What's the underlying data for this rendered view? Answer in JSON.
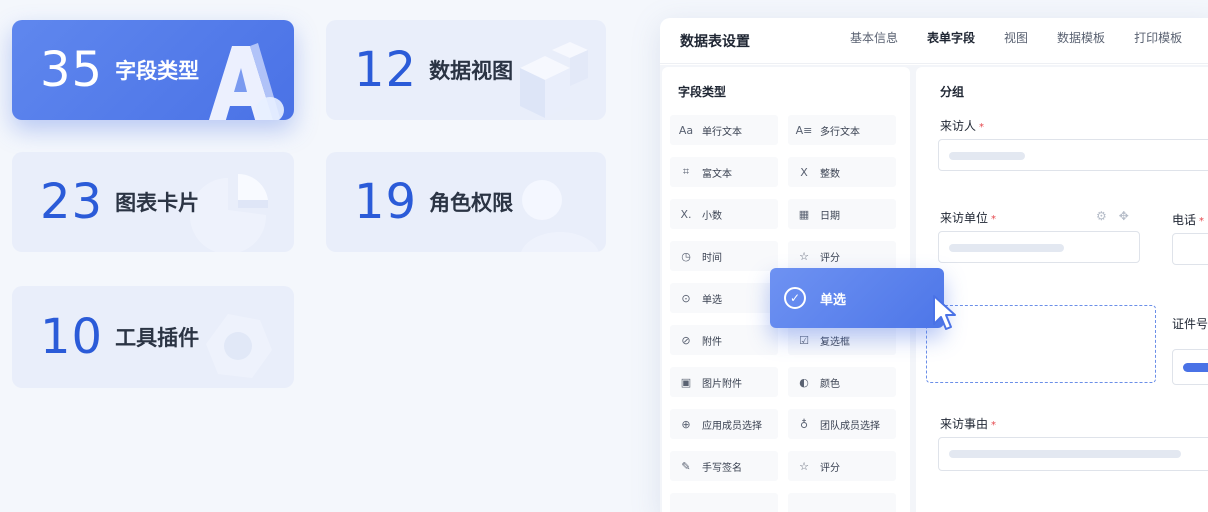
{
  "stats": [
    {
      "number": "35",
      "label": "字段类型",
      "active": true
    },
    {
      "number": "12",
      "label": "数据视图",
      "active": false
    },
    {
      "number": "23",
      "label": "图表卡片",
      "active": false
    },
    {
      "number": "19",
      "label": "角色权限",
      "active": false
    },
    {
      "number": "10",
      "label": "工具插件",
      "active": false
    }
  ],
  "panel": {
    "title": "数据表设置",
    "tabs": [
      {
        "label": "基本信息",
        "active": false
      },
      {
        "label": "表单字段",
        "active": true
      },
      {
        "label": "视图",
        "active": false
      },
      {
        "label": "数据模板",
        "active": false
      },
      {
        "label": "打印模板",
        "active": false
      }
    ]
  },
  "field_types": {
    "title": "字段类型",
    "items": [
      {
        "label": "单行文本",
        "icon": "single-line-text-icon"
      },
      {
        "label": "多行文本",
        "icon": "multi-line-text-icon"
      },
      {
        "label": "富文本",
        "icon": "rich-text-icon"
      },
      {
        "label": "整数",
        "icon": "integer-icon"
      },
      {
        "label": "小数",
        "icon": "decimal-icon"
      },
      {
        "label": "日期",
        "icon": "calendar-icon"
      },
      {
        "label": "时间",
        "icon": "clock-icon"
      },
      {
        "label": "评分",
        "icon": "star-icon"
      },
      {
        "label": "单选",
        "icon": "radio-icon"
      },
      {
        "label": "",
        "icon": ""
      },
      {
        "label": "附件",
        "icon": "paperclip-icon"
      },
      {
        "label": "复选框",
        "icon": "checkbox-icon"
      },
      {
        "label": "图片附件",
        "icon": "image-icon"
      },
      {
        "label": "颜色",
        "icon": "palette-icon"
      },
      {
        "label": "应用成员选择",
        "icon": "app-member-icon"
      },
      {
        "label": "团队成员选择",
        "icon": "team-member-icon"
      },
      {
        "label": "手写签名",
        "icon": "pen-icon"
      },
      {
        "label": "评分",
        "icon": "star-icon"
      }
    ]
  },
  "form": {
    "group_label": "分组",
    "fields": [
      {
        "label": "来访人",
        "required": true
      },
      {
        "label": "来访单位",
        "required": true
      },
      {
        "label": "电话",
        "required": true
      },
      {
        "label": "证件号",
        "required": false
      },
      {
        "label": "来访事由",
        "required": true
      }
    ]
  },
  "drag_chip": {
    "label": "单选",
    "icon": "radio-check-icon"
  }
}
